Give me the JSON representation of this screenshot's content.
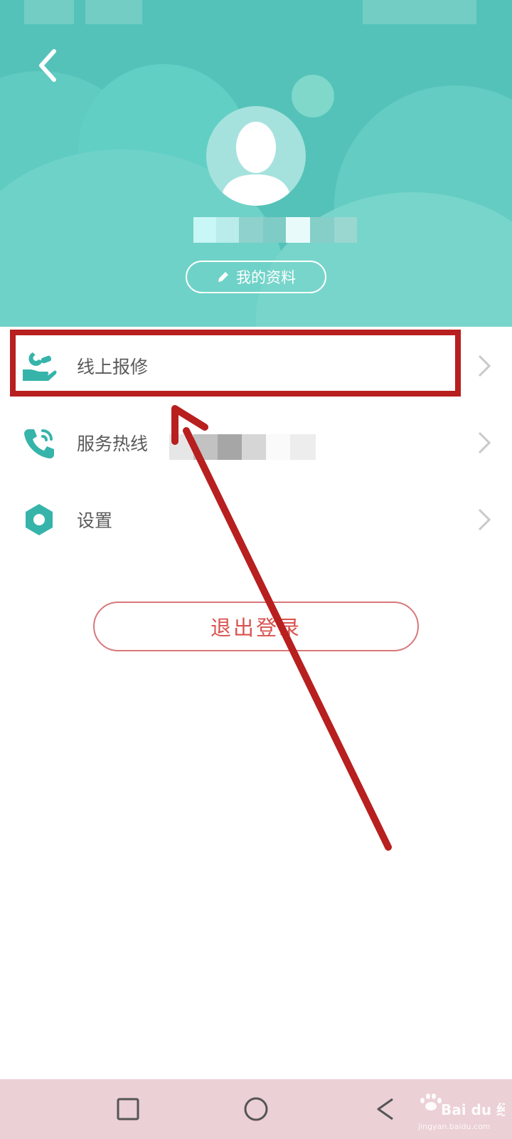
{
  "header": {
    "back_icon": "chevron-left-icon",
    "avatar_icon": "user-silhouette-icon",
    "profile_button": {
      "label": "我的资料",
      "icon": "pencil-icon"
    }
  },
  "menu": [
    {
      "label": "线上报修",
      "icon": "repair-hand-icon"
    },
    {
      "label": "服务热线",
      "icon": "phone-call-icon"
    },
    {
      "label": "设置",
      "icon": "hexagon-settings-icon"
    }
  ],
  "logout_button": {
    "label": "退出登录"
  },
  "navbar": {
    "icons": [
      "recent-apps-icon",
      "home-icon",
      "back-icon"
    ]
  },
  "watermark": {
    "brand": "Bai du 经验",
    "url": "jingyan.baidu.com"
  },
  "colors": {
    "header_bg": "#55c2b9",
    "accent": "#36b4aa",
    "logout": "#d9534f",
    "annotation": "#b81f1f",
    "navbar_bg": "#ebd0d5"
  }
}
